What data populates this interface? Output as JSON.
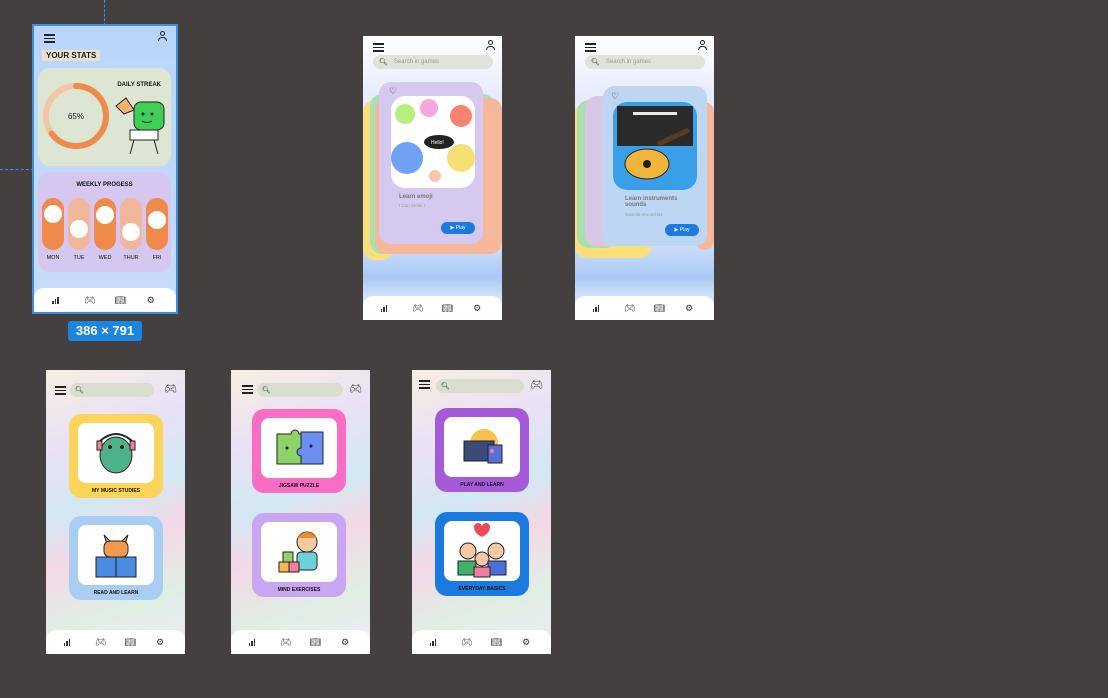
{
  "canvas": {
    "selection_size": "386 × 791"
  },
  "stats_screen": {
    "title": "YOUR STATS",
    "streak_label": "DAILY STREAK",
    "streak_percent": "65%",
    "streak_value": 0.65,
    "weekly_label": "WEEKLY PROGESS",
    "days": [
      {
        "label": "MON",
        "level": 0.85
      },
      {
        "label": "TUE",
        "level": 0.35
      },
      {
        "label": "WED",
        "level": 0.8
      },
      {
        "label": "THUR",
        "level": 0.25
      },
      {
        "label": "FRI",
        "level": 0.65
      }
    ]
  },
  "game_screen_1": {
    "search_placeholder": "Search in games",
    "card_title": "Learn emoji",
    "card_subtitle": "I Can Smile !",
    "play_label": "▶ Play"
  },
  "game_screen_2": {
    "search_placeholder": "Search in games",
    "card_title": "Learn instruments sounds",
    "card_subtitle": "Sounds Around Us",
    "play_label": "▶ Play"
  },
  "category_screen_1": {
    "tiles": [
      {
        "label": "MY MUSIC STUDIES",
        "color": "#fbd45c"
      },
      {
        "label": "READ AND LEARN",
        "color": "#a9cdf3"
      }
    ]
  },
  "category_screen_2": {
    "tiles": [
      {
        "label": "JIGSAW PUZZLE",
        "color": "#f96dc4"
      },
      {
        "label": "MIND EXERCISES",
        "color": "#c8a6f2"
      }
    ]
  },
  "category_screen_3": {
    "tiles": [
      {
        "label": "PLAY AND LEARN",
        "color": "#a55ad8"
      },
      {
        "label": "EVERYDAY BASICS",
        "color": "#1a7ae0"
      }
    ]
  },
  "nav": {
    "icons": [
      "chart-icon",
      "gamepad-icon",
      "book-icon",
      "settings-icon"
    ]
  },
  "colors": {
    "accent": "#1a7ae0",
    "orange": "#f08a4b",
    "selection": "#3b8fe0"
  }
}
